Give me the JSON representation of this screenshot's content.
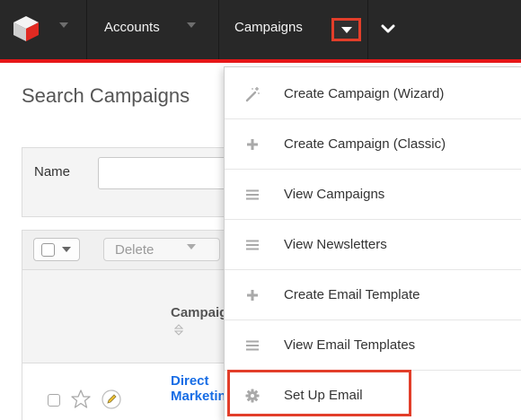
{
  "nav": {
    "accounts_label": "Accounts",
    "campaigns_label": "Campaigns",
    "bar_color": "#282828",
    "accent_color": "#e61718",
    "highlight_color": "#e23e2a"
  },
  "page": {
    "title": "Search Campaigns",
    "filter": {
      "label": "Name",
      "value": ""
    },
    "toolbar": {
      "delete_label": "Delete"
    },
    "list": {
      "column_name": "Campaign",
      "rows": [
        {
          "name": "Direct\nMarketing"
        }
      ]
    }
  },
  "menu": {
    "items": [
      {
        "label": "Create Campaign (Wizard)",
        "icon": "magic-wand-icon"
      },
      {
        "label": "Create Campaign (Classic)",
        "icon": "plus-icon"
      },
      {
        "label": "View Campaigns",
        "icon": "list-icon"
      },
      {
        "label": "View Newsletters",
        "icon": "list-icon"
      },
      {
        "label": "Create Email Template",
        "icon": "plus-icon"
      },
      {
        "label": "View Email Templates",
        "icon": "list-icon"
      },
      {
        "label": "Set Up Email",
        "icon": "gear-icon"
      }
    ],
    "highlighted_item": "Set Up Email"
  }
}
